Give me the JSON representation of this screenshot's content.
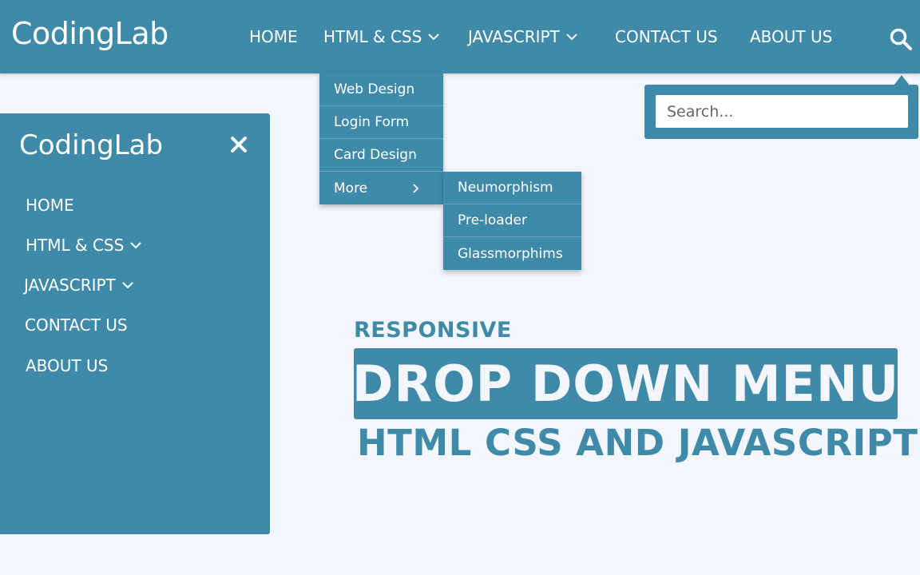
{
  "brand": {
    "name": "CodingLab"
  },
  "nav": {
    "items": [
      {
        "label": "HOME"
      },
      {
        "label": "HTML & CSS"
      },
      {
        "label": "JAVASCRIPT"
      },
      {
        "label": "CONTACT US"
      },
      {
        "label": "ABOUT US"
      }
    ]
  },
  "dropdown": {
    "items": [
      {
        "label": "Web Design"
      },
      {
        "label": "Login Form"
      },
      {
        "label": "Card Design"
      },
      {
        "label": "More"
      }
    ],
    "submenu": [
      {
        "label": "Neumorphism"
      },
      {
        "label": "Pre-loader"
      },
      {
        "label": "Glassmorphims"
      }
    ]
  },
  "search": {
    "placeholder": "Search..."
  },
  "sidebar": {
    "title": "CodingLab",
    "items": [
      {
        "label": "HOME"
      },
      {
        "label": "HTML & CSS"
      },
      {
        "label": "JAVASCRIPT"
      },
      {
        "label": "CONTACT US"
      },
      {
        "label": "ABOUT US"
      }
    ]
  },
  "hero": {
    "kicker": "RESPONSIVE",
    "headline": "DROP DOWN MENU",
    "subline": "HTML CSS AND JAVASCRIPT"
  },
  "colors": {
    "accent": "#3e8aa8",
    "background": "#f3f6fd",
    "text_on_accent": "#ffffff"
  },
  "icons": {
    "search": "search-icon",
    "chevron": "chevron-down-icon",
    "arrow": "chevron-right-icon",
    "close": "close-icon"
  }
}
